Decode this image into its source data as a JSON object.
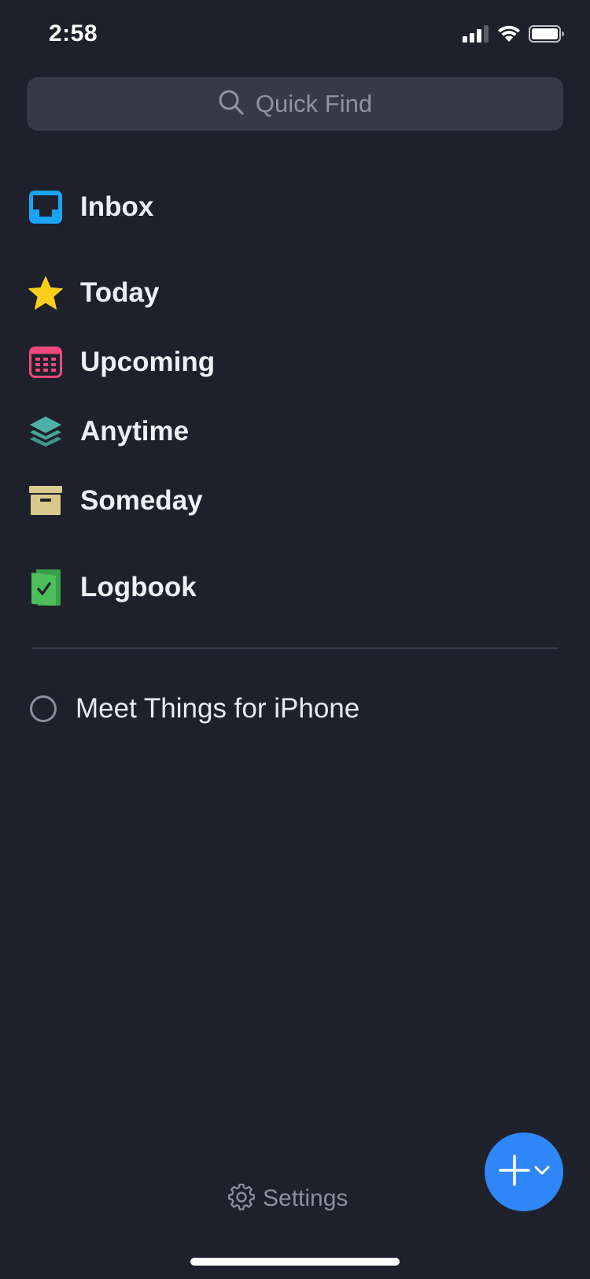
{
  "status_bar": {
    "time": "2:58",
    "icons": [
      "cellular-signal-icon",
      "wifi-icon",
      "battery-icon"
    ]
  },
  "search": {
    "placeholder": "Quick Find",
    "icon": "search-icon"
  },
  "nav": {
    "inbox": {
      "label": "Inbox",
      "icon": "inbox-tray-icon",
      "color": "#1aa3f5"
    },
    "today": {
      "label": "Today",
      "icon": "star-icon",
      "color": "#f8cf1d"
    },
    "upcoming": {
      "label": "Upcoming",
      "icon": "calendar-icon",
      "color": "#f0487d"
    },
    "anytime": {
      "label": "Anytime",
      "icon": "layers-icon",
      "color": "#4db3a4"
    },
    "someday": {
      "label": "Someday",
      "icon": "archive-box-icon",
      "color": "#d8c98c"
    },
    "logbook": {
      "label": "Logbook",
      "icon": "logbook-check-icon",
      "color": "#4cbf5a"
    }
  },
  "tasks": [
    {
      "label": "Meet Things for iPhone",
      "completed": false
    }
  ],
  "footer": {
    "settings_label": "Settings",
    "settings_icon": "gear-icon"
  },
  "fab": {
    "icon": "plus-icon",
    "secondary_icon": "chevron-down-icon",
    "color": "#2f86f6"
  }
}
